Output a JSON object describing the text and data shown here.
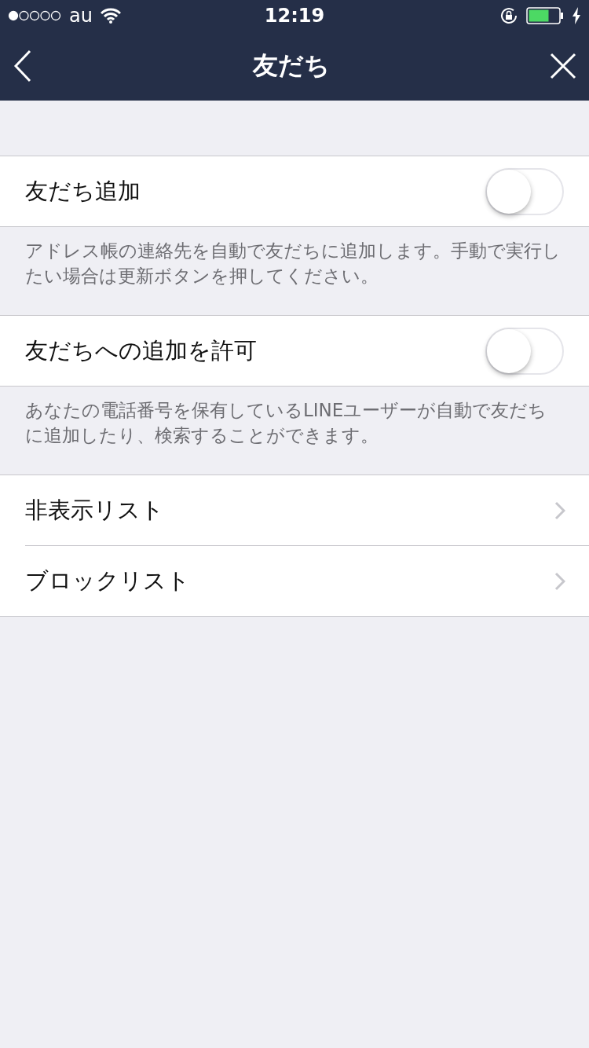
{
  "status_bar": {
    "carrier": "au",
    "time": "12:19"
  },
  "nav": {
    "title": "友だち"
  },
  "sections": [
    {
      "kind": "toggle",
      "label": "友だち追加",
      "on": false,
      "note": "アドレス帳の連絡先を自動で友だちに追加します。手動で実行したい場合は更新ボタンを押してください。"
    },
    {
      "kind": "toggle",
      "label": "友だちへの追加を許可",
      "on": false,
      "note": "あなたの電話番号を保有しているLINEユーザーが自動で友だちに追加したり、検索することができます。"
    },
    {
      "kind": "links",
      "items": [
        {
          "label": "非表示リスト"
        },
        {
          "label": "ブロックリスト"
        }
      ]
    }
  ]
}
